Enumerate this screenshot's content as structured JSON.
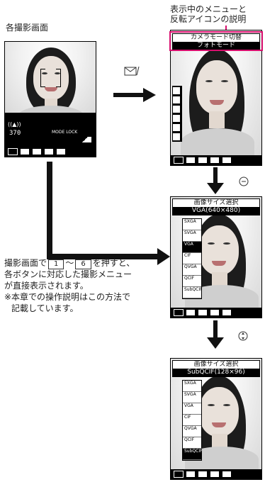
{
  "labels": {
    "screen_label": "各撮影画面",
    "menu_label_line1": "表示中のメニューと",
    "menu_label_line2": "反転アイコンの説明"
  },
  "screen1": {
    "status_battery": "((▲))",
    "shots": "370",
    "mode_text": "MODE LOCK"
  },
  "screen2": {
    "header_title": "カメラモード切替",
    "header_sub": "フォトモード"
  },
  "screen3": {
    "header_title": "画像サイズ選択",
    "header_sub": "VGA(640×480)",
    "sizes": [
      "SXGA",
      "SVGA",
      "VGA",
      "CIF",
      "QVGA",
      "QCIF",
      "SubQCIF"
    ]
  },
  "screen4": {
    "header_title": "画像サイズ選択",
    "header_sub": "SubQCIF(128×96)",
    "sizes": [
      "SXGA",
      "SVGA",
      "VGA",
      "CIF",
      "QVGA",
      "QCIF",
      "SubQCIF"
    ]
  },
  "note": {
    "line1_pre": "撮影画面で",
    "key1": "1",
    "tilde": "〜",
    "key6": "6",
    "line1_post": "を押すと、",
    "line2": "各ボタンに対応した撮影メニュー",
    "line3": "が直接表示されます。",
    "line4": "※本章での操作説明はこの方法で",
    "line5": "記載しています。"
  },
  "icons": [
    "mail-icon",
    "select-key-icon",
    "scroll-key-icon"
  ],
  "colors": {
    "accent": "#d80f6e",
    "arrow": "#111111"
  }
}
